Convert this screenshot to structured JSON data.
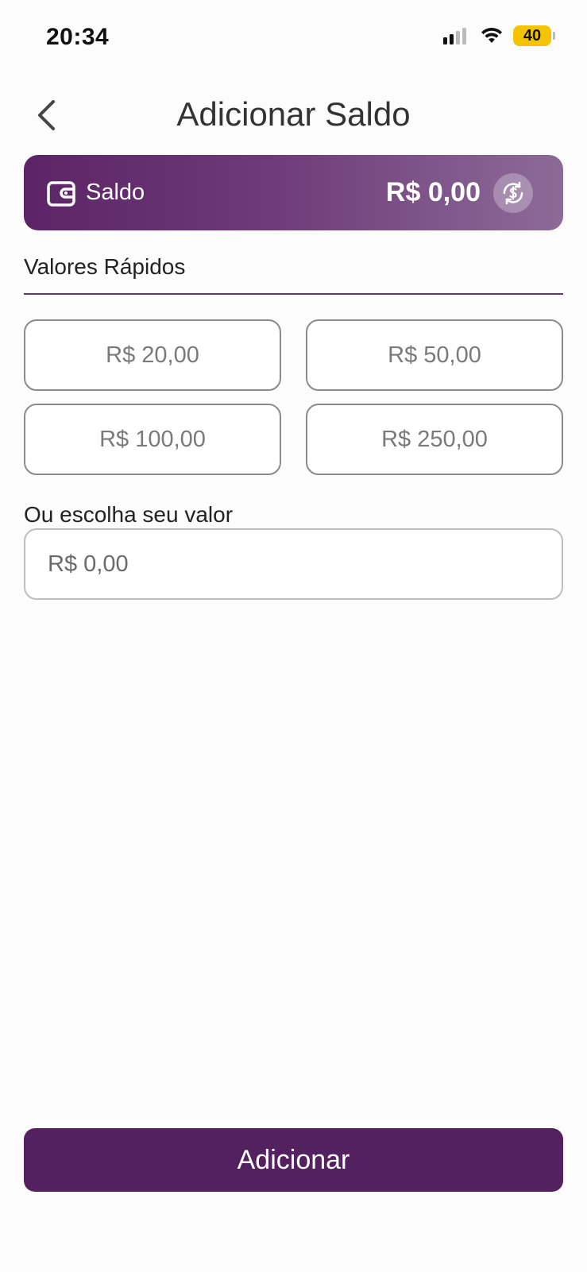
{
  "status_bar": {
    "time": "20:34",
    "battery": "40"
  },
  "header": {
    "title": "Adicionar Saldo"
  },
  "balance": {
    "label": "Saldo",
    "value": "R$ 0,00"
  },
  "quick": {
    "title": "Valores Rápidos",
    "options": [
      "R$ 20,00",
      "R$ 50,00",
      "R$ 100,00",
      "R$ 250,00"
    ]
  },
  "custom": {
    "label": "Ou escolha seu valor",
    "placeholder": "R$ 0,00"
  },
  "actions": {
    "submit_label": "Adicionar"
  },
  "colors": {
    "primary": "#542160",
    "battery": "#f5c400"
  }
}
